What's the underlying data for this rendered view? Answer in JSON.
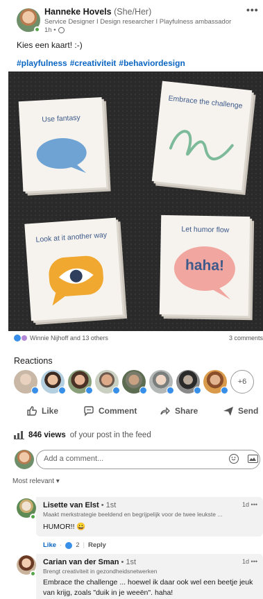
{
  "post": {
    "author_name": "Hanneke Hovels",
    "author_pronouns": "(She/Her)",
    "author_headline": "Service Designer I Design researcher I Playfulness ambassador",
    "time": "1h •",
    "more": "•••",
    "text": "Kies een kaart! :-)",
    "hashtags": [
      "#playfulness",
      "#creativiteit",
      "#behaviordesign"
    ]
  },
  "image": {
    "cards": [
      {
        "label": "Use fantasy",
        "bubble_color": "#6ea3d4"
      },
      {
        "label": "Embrace the challenge",
        "bubble_color": "#7dba9a"
      },
      {
        "label": "Look at it another way",
        "bubble_color": "#f0a830"
      },
      {
        "label": "Let humor flow",
        "bubble_color": "#f1a6a0",
        "bubble_text": "haha!"
      }
    ]
  },
  "social": {
    "reactions_text": "Winnie Nijhoff and 13 others",
    "comments_text": "3 comments",
    "reactions_title": "Reactions",
    "more_reactors": "+6"
  },
  "actions": {
    "like": "Like",
    "comment": "Comment",
    "share": "Share",
    "send": "Send"
  },
  "views": {
    "count": "846 views",
    "suffix": "of your post in the feed"
  },
  "comment_input": {
    "placeholder": "Add a comment..."
  },
  "sort": {
    "label": "Most relevant ▾"
  },
  "comments": [
    {
      "name": "Lisette van Elst",
      "degree": "• 1st",
      "headline": "Maakt merkstrategie beeldend en begrijpelijk voor de twee leukste ...",
      "time": "1d •••",
      "body": "HUMOR!! 😀",
      "like": "Like",
      "dot": "·",
      "like_count": "2",
      "reply": "Reply"
    },
    {
      "name": "Carian van der Sman",
      "degree": "• 1st",
      "headline": "Brengt creativiteit in gezondheidsnetwerken",
      "time": "1d •••",
      "body_line1": "Embrace the challenge ... hoewel ik daar ook wel een beetje jeuk",
      "body_line2": "van krijg, zoals \"duik in je weeën\". haha!"
    }
  ],
  "colors": {
    "link_blue": "#0a66c2",
    "like_blue": "#378fe9",
    "online_green": "#57a64b"
  }
}
